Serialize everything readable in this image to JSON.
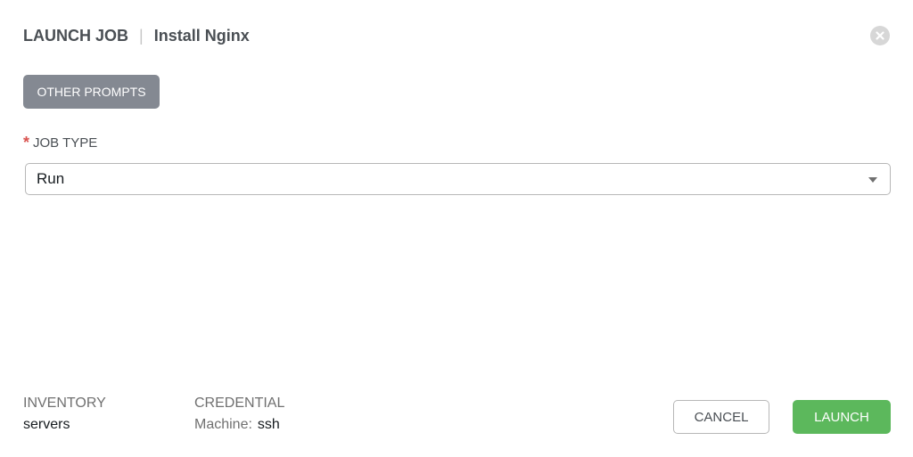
{
  "header": {
    "title": "LAUNCH JOB",
    "separator": "|",
    "job_name": "Install Nginx",
    "close_icon": "close-circle-icon"
  },
  "prompts": {
    "other_prompts_label": "OTHER PROMPTS"
  },
  "job_type": {
    "required_mark": "*",
    "label": "JOB TYPE",
    "selected_value": "Run",
    "caret_icon": "chevron-down-icon"
  },
  "summary": {
    "inventory_title": "INVENTORY",
    "inventory_value": "servers",
    "credential_title": "CREDENTIAL",
    "credential_kind": "Machine:",
    "credential_value": "ssh"
  },
  "actions": {
    "cancel_label": "CANCEL",
    "launch_label": "LAUNCH"
  },
  "colors": {
    "launch_button": "#5cb85c",
    "other_prompts_button": "#848992",
    "required_mark": "#d9534f"
  }
}
